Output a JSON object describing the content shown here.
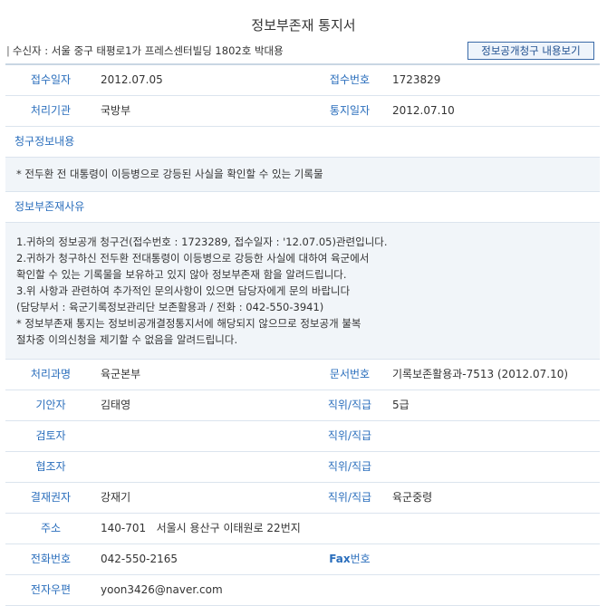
{
  "title": "정보부존재 통지서",
  "recipient": {
    "bar": "|",
    "text": "수신자 : 서울 중구 태평로1가 프레스센터빌딩 1802호 박대용"
  },
  "view_button": "정보공개청구 내용보기",
  "receipt": {
    "date_label": "접수일자",
    "date_value": "2012.07.05",
    "number_label": "접수번호",
    "number_value": "1723829"
  },
  "processing": {
    "org_label": "처리기관",
    "org_value": "국방부",
    "notice_date_label": "통지일자",
    "notice_date_value": "2012.07.10"
  },
  "request": {
    "heading": "청구정보내용",
    "body": "* 전두환 전 대통령이 이등병으로 강등된 사실을 확인할 수 있는 기록물"
  },
  "reason": {
    "heading": "정보부존재사유",
    "lines": [
      "1.귀하의 정보공개 청구건(접수번호 : 1723289, 접수일자 : '12.07.05)관련입니다.",
      "2.귀하가 청구하신 전두환 전대통령이 이등병으로 강등한 사실에 대하여 육군에서",
      "확인할 수 있는 기록물을 보유하고 있지 않아 정보부존재 함을 알려드립니다.",
      "3.위 사항과 관련하여 추가적인 문의사항이 있으면 담당자에게 문의 바랍니다",
      "(담당부서 : 육군기록정보관리단 보존활용과 / 전화 : 042-550-3941)",
      "* 정보부존재 통지는 정보비공개결정통지서에 해당되지 않으므로 정보공개 불복",
      "절차중 이의신청을 제기할 수 없음을 알려드립니다."
    ]
  },
  "dept": {
    "label": "처리과명",
    "value": "육군본부",
    "doc_label": "문서번호",
    "doc_value": "기록보존활용과-7513 (2012.07.10)"
  },
  "drafter": {
    "label": "기안자",
    "value": "김태영",
    "rank_label": "직위/직급",
    "rank_value": "5급"
  },
  "reviewer": {
    "label": "검토자",
    "value": "",
    "rank_label": "직위/직급",
    "rank_value": ""
  },
  "cooperator": {
    "label": "협조자",
    "value": "",
    "rank_label": "직위/직급",
    "rank_value": ""
  },
  "approver": {
    "label": "결재권자",
    "value": "강재기",
    "rank_label": "직위/직급",
    "rank_value": "육군중령"
  },
  "address": {
    "label": "주소",
    "value": "140-701   서울시 용산구 이태원로 22번지"
  },
  "phone": {
    "label": "전화번호",
    "value": "042-550-2165",
    "fax_prefix": "Fax",
    "fax_suffix": "번호",
    "fax_value": ""
  },
  "email": {
    "label": "전자우편",
    "value": "yoon3426@naver.com"
  }
}
